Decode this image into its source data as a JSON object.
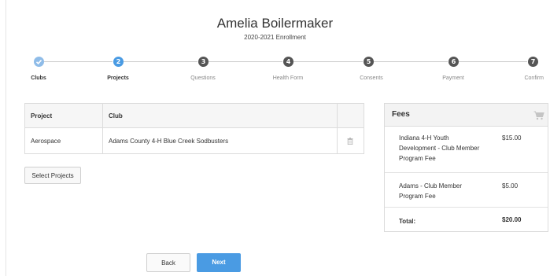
{
  "header": {
    "name": "Amelia Boilermaker",
    "enrollment": "2020-2021 Enrollment"
  },
  "stepper": {
    "steps": [
      {
        "number": "",
        "label": "Clubs",
        "state": "done",
        "icon": "check-icon"
      },
      {
        "number": "2",
        "label": "Projects",
        "state": "active"
      },
      {
        "number": "3",
        "label": "Questions",
        "state": "pending"
      },
      {
        "number": "4",
        "label": "Health Form",
        "state": "pending"
      },
      {
        "number": "5",
        "label": "Consents",
        "state": "pending"
      },
      {
        "number": "6",
        "label": "Payment",
        "state": "pending"
      },
      {
        "number": "7",
        "label": "Confirm",
        "state": "pending"
      }
    ]
  },
  "projects_table": {
    "columns": [
      "Project",
      "Club",
      ""
    ],
    "rows": [
      {
        "project": "Aerospace",
        "club": "Adams County 4-H Blue Creek Sodbusters",
        "action_icon": "trash-icon"
      }
    ]
  },
  "buttons": {
    "select_projects": "Select Projects",
    "back": "Back",
    "next": "Next"
  },
  "fees": {
    "title": "Fees",
    "icon": "cart-icon",
    "items": [
      {
        "name": "Indiana 4-H Youth Development - Club Member Program Fee",
        "amount": "$15.00"
      },
      {
        "name": "Adams - Club Member Program Fee",
        "amount": "$5.00"
      }
    ],
    "total_label": "Total:",
    "total_amount": "$20.00"
  },
  "colors": {
    "accent": "#4a9be3",
    "done": "#8fbce8",
    "pending": "#555555"
  }
}
